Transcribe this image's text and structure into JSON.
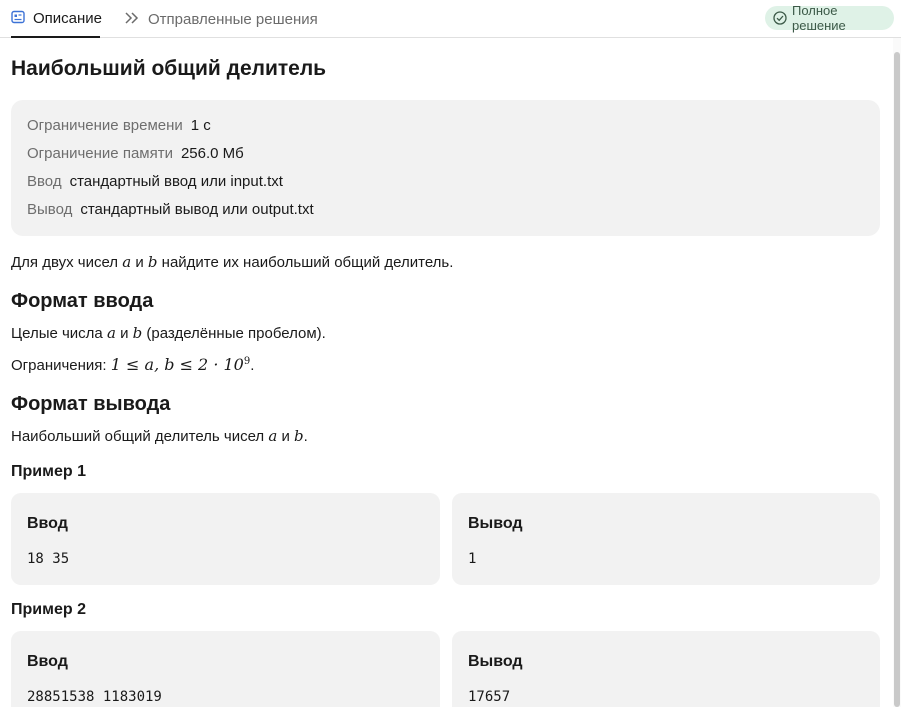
{
  "tabs": {
    "description": "Описание",
    "submissions": "Отправленные решения"
  },
  "status_badge": "Полное решение",
  "problem": {
    "title": "Наибольший общий делитель",
    "limits": [
      {
        "key": "Ограничение времени",
        "value": "1 с"
      },
      {
        "key": "Ограничение памяти",
        "value": "256.0 Мб"
      },
      {
        "key": "Ввод",
        "value": "стандартный ввод или input.txt"
      },
      {
        "key": "Вывод",
        "value": "стандартный вывод или output.txt"
      }
    ],
    "statement": {
      "pre": "Для двух чисел ",
      "var_a": "a",
      "mid": " и ",
      "var_b": "b",
      "post": " найдите их наибольший общий делитель."
    },
    "input_format": {
      "heading": "Формат ввода",
      "line1_pre": "Целые числа ",
      "line1_a": "a",
      "line1_mid": " и ",
      "line1_b": "b",
      "line1_post": " (разделённые пробелом).",
      "line2_pre": "Ограничения: ",
      "line2_math": "1 ≤ a, b ≤ 2 · 10",
      "line2_sup": "9",
      "line2_post": "."
    },
    "output_format": {
      "heading": "Формат вывода",
      "pre": "Наибольший общий делитель чисел ",
      "a": "a",
      "mid": " и ",
      "b": "b",
      "post": "."
    },
    "examples": [
      {
        "title": "Пример 1",
        "input_label": "Ввод",
        "input": "18 35",
        "output_label": "Вывод",
        "output": "1"
      },
      {
        "title": "Пример 2",
        "input_label": "Ввод",
        "input": "28851538 1183019",
        "output_label": "Вывод",
        "output": "17657"
      }
    ]
  }
}
